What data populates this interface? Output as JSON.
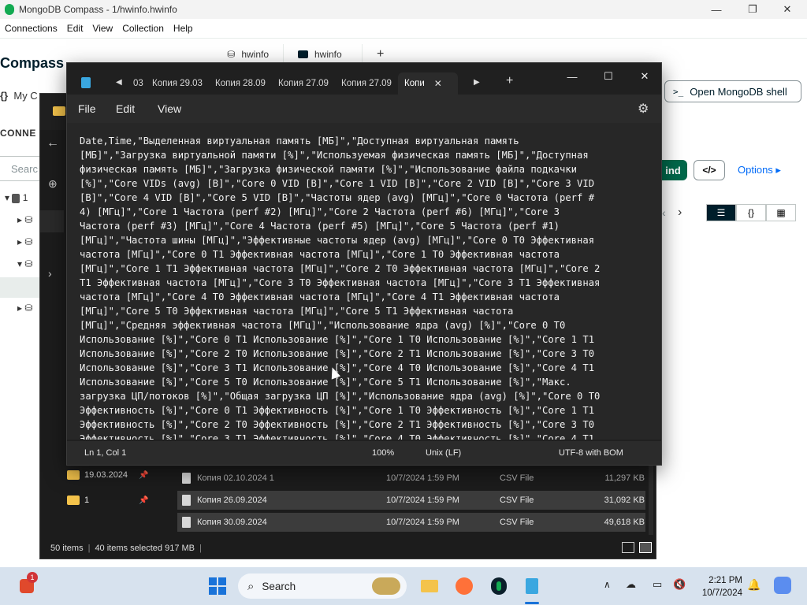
{
  "compass": {
    "title": "MongoDB Compass - 1/hwinfo.hwinfo",
    "menu": [
      "Connections",
      "Edit",
      "View",
      "Collection",
      "Help"
    ],
    "brand": "Compass",
    "my_connections": "My C",
    "connections_header": "CONNE",
    "search_placeholder": "Searc",
    "tree_root_label": "1",
    "tabs": [
      {
        "label": "hwinfo",
        "icon": "database-icon"
      },
      {
        "label": "hwinfo",
        "icon": "folder-icon"
      }
    ],
    "add_tab": "+",
    "shell_button": "Open MongoDB shell",
    "find_button": "ind",
    "code_button": "</>",
    "options_link": "Options",
    "view_buttons": [
      "list-view",
      "json-view",
      "table-view"
    ]
  },
  "explorer": {
    "sidebar_items": [
      {
        "label": "19.03.2024"
      },
      {
        "label": "1"
      }
    ],
    "files": [
      {
        "name": "Копия 02.10.2024 1",
        "date": "10/7/2024 1:59 PM",
        "type": "CSV File",
        "size": "11,297 KB"
      },
      {
        "name": "Копия 26.09.2024",
        "date": "10/7/2024 1:59 PM",
        "type": "CSV File",
        "size": "31,092 KB"
      },
      {
        "name": "Копия 30.09.2024",
        "date": "10/7/2024 1:59 PM",
        "type": "CSV File",
        "size": "49,618 KB"
      }
    ],
    "status_items": "50 items",
    "status_selected": "40 items selected  917 MB"
  },
  "notepad": {
    "tabs": [
      "03",
      "Копия 29.03",
      "Копия 28.09",
      "Копия 27.09",
      "Копия 27.09",
      "Копи"
    ],
    "menu": [
      "File",
      "Edit",
      "View"
    ],
    "text_lines": [
      "Date,Time,\"Выделенная виртуальная память [МБ]\",\"Доступная виртуальная память",
      "[МБ]\",\"Загрузка виртуальной памяти [%]\",\"Используемая физическая память [МБ]\",\"Доступная",
      "физическая память [МБ]\",\"Загрузка физической памяти [%]\",\"Использование файла подкачки",
      "[%]\",\"Core VIDs (avg) [B]\",\"Core 0 VID [B]\",\"Core 1 VID [B]\",\"Core 2 VID [B]\",\"Core 3 VID",
      "[B]\",\"Core 4 VID [B]\",\"Core 5 VID [B]\",\"Частоты ядер (avg) [МГц]\",\"Core 0 Частота (perf #",
      "4) [МГц]\",\"Core 1 Частота (perf #2) [МГц]\",\"Core 2 Частота (perf #6) [МГц]\",\"Core 3",
      "Частота (perf #3) [МГц]\",\"Core 4 Частота (perf #5) [МГц]\",\"Core 5 Частота (perf #1)",
      "[МГц]\",\"Частота шины [МГц]\",\"Эффективные частоты ядер (avg) [МГц]\",\"Core 0 T0 Эффективная",
      "частота [МГц]\",\"Core 0 T1 Эффективная частота [МГц]\",\"Core 1 T0 Эффективная частота",
      "[МГц]\",\"Core 1 T1 Эффективная частота [МГц]\",\"Core 2 T0 Эффективная частота [МГц]\",\"Core 2",
      "T1 Эффективная частота [МГц]\",\"Core 3 T0 Эффективная частота [МГц]\",\"Core 3 T1 Эффективная",
      "частота [МГц]\",\"Core 4 T0 Эффективная частота [МГц]\",\"Core 4 T1 Эффективная частота",
      "[МГц]\",\"Core 5 T0 Эффективная частота [МГц]\",\"Core 5 T1 Эффективная частота",
      "[МГц]\",\"Средняя эффективная частота [МГц]\",\"Использование ядра (avg) [%]\",\"Core 0 T0",
      "Использование [%]\",\"Core 0 T1 Использование [%]\",\"Core 1 T0 Использование [%]\",\"Core 1 T1",
      "Использование [%]\",\"Core 2 T0 Использование [%]\",\"Core 2 T1 Использование [%]\",\"Core 3 T0",
      "Использование [%]\",\"Core 3 T1 Использование [%]\",\"Core 4 T0 Использование [%]\",\"Core 4 T1",
      "Использование [%]\",\"Core 5 T0 Использование [%]\",\"Core 5 T1 Использование [%]\",\"Макс.",
      "загрузка ЦП/потоков [%]\",\"Общая загрузка ЦП [%]\",\"Использование ядра (avg) [%]\",\"Core 0 T0",
      "Эффективность [%]\",\"Core 0 T1 Эффективность [%]\",\"Core 1 T0 Эффективность [%]\",\"Core 1 T1",
      "Эффективность [%]\",\"Core 2 T0 Эффективность [%]\",\"Core 2 T1 Эффективность [%]\",\"Core 3 T0",
      "Эффективность [%]\",\"Core 3 T1 Эффективность [%]\",\"Core 4 T0 Эффективность [%]\",\"Core 4 T1"
    ],
    "status": {
      "position": "Ln 1, Col 1",
      "zoom": "100%",
      "line_ending": "Unix (LF)",
      "encoding": "UTF-8 with BOM"
    }
  },
  "taskbar": {
    "search_label": "Search",
    "time": "2:21 PM",
    "date": "10/7/2024",
    "notification_badge": "1"
  }
}
